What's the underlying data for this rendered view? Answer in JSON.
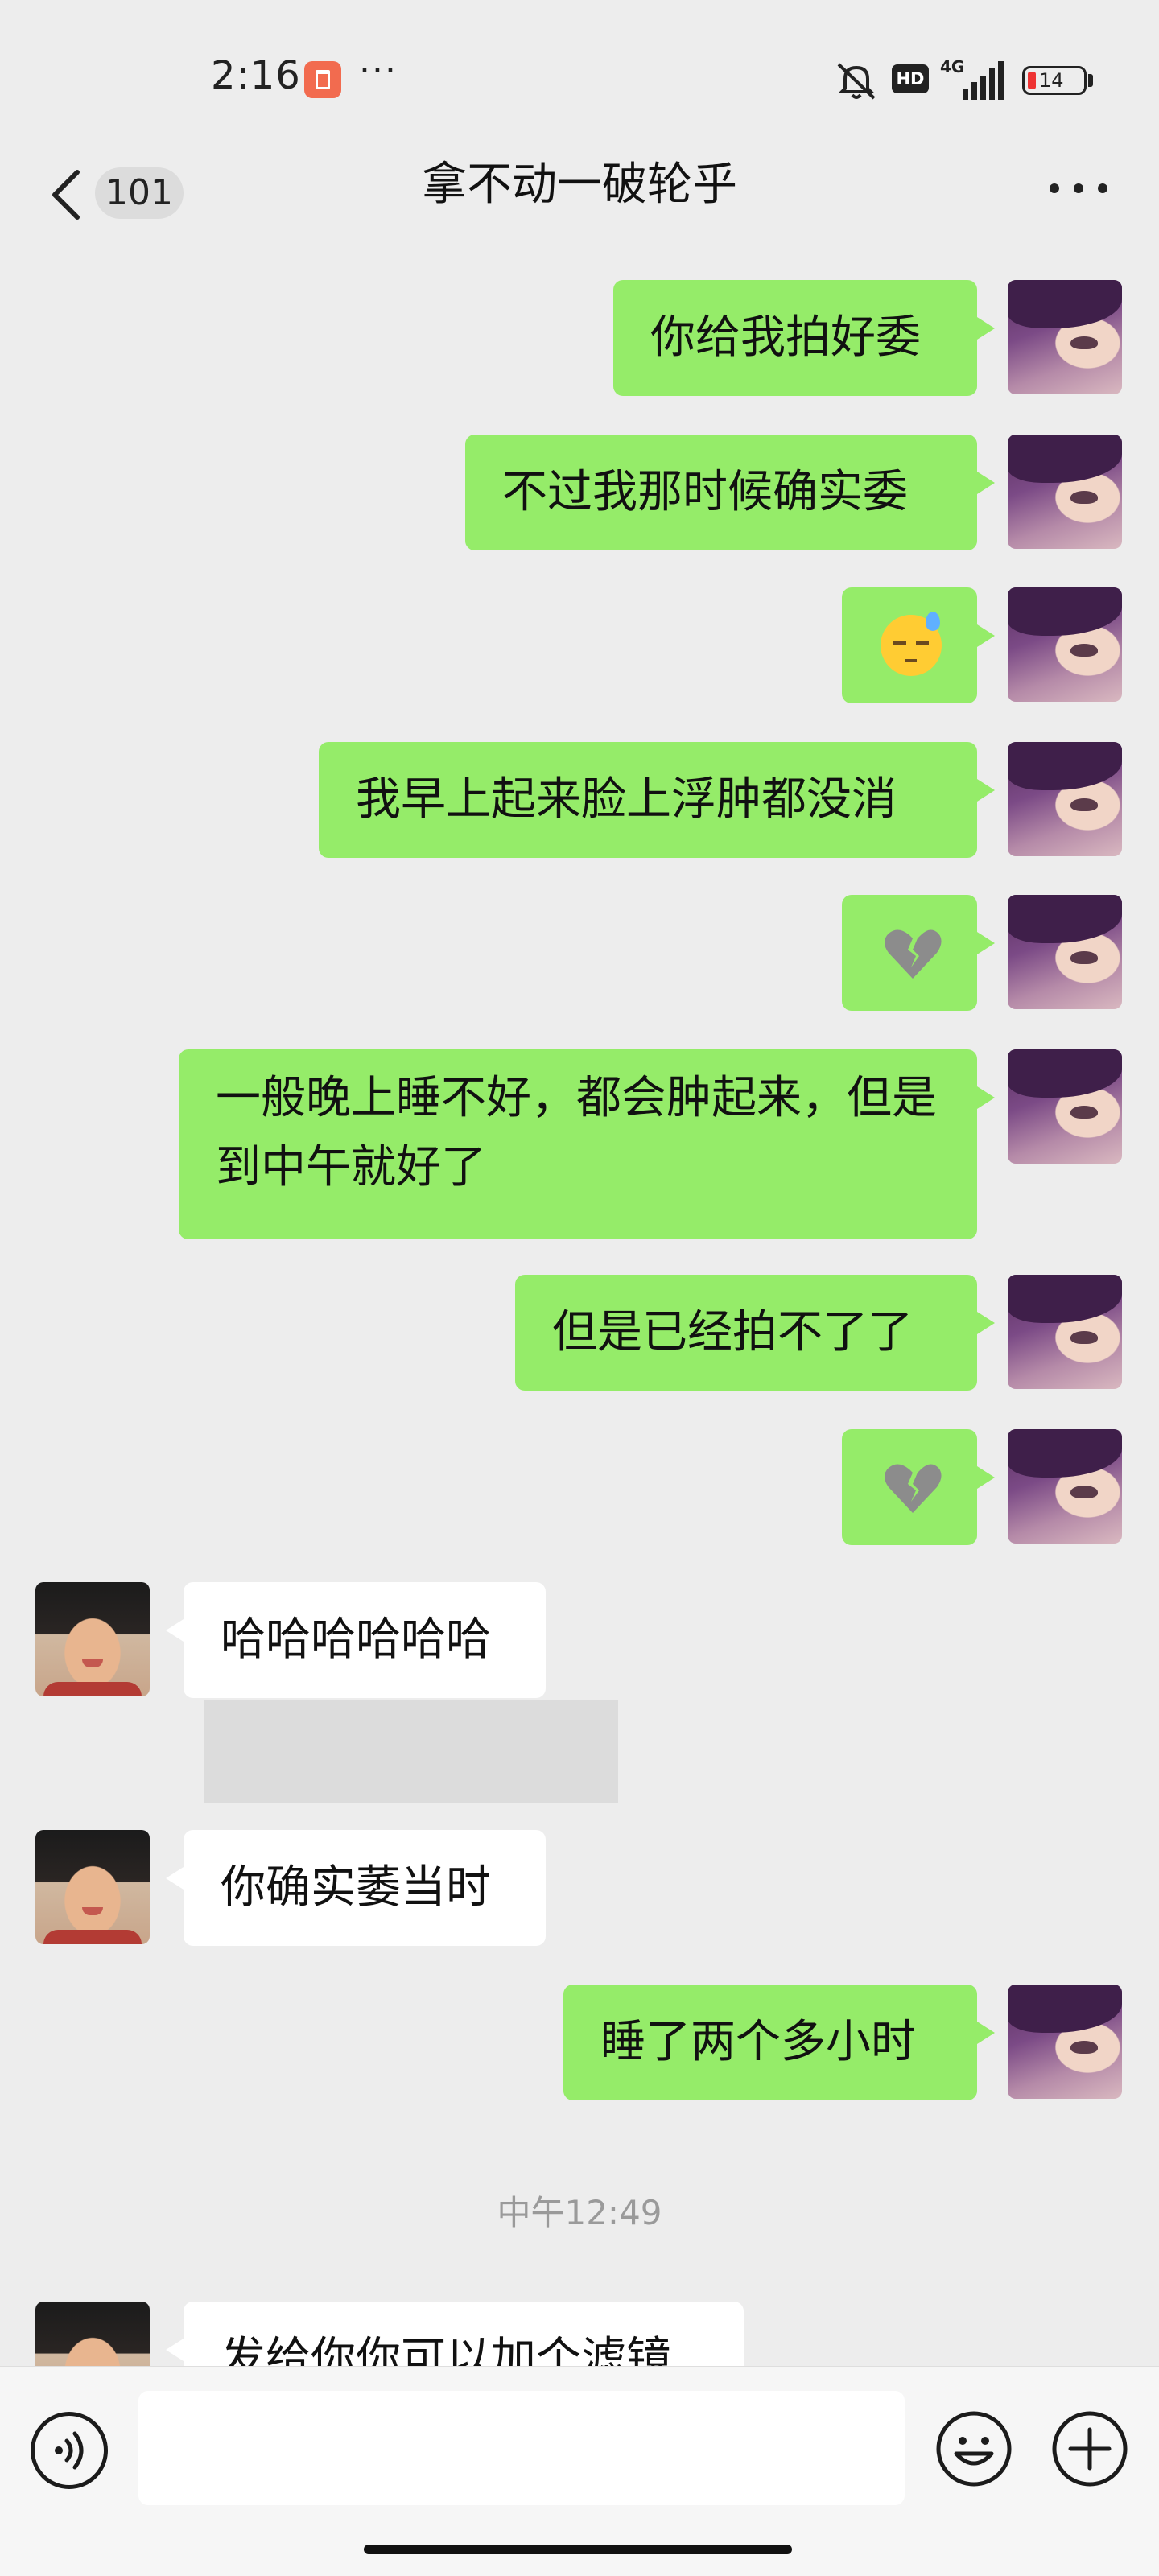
{
  "status_bar": {
    "time": "2:16",
    "more": "···",
    "hd": "HD",
    "network": "4G",
    "battery": "14"
  },
  "header": {
    "back_count": "101",
    "title": "拿不动一破轮乎"
  },
  "messages": [
    {
      "side": "me",
      "type": "text",
      "text": "你给我拍好委"
    },
    {
      "side": "me",
      "type": "text",
      "text": "不过我那时候确实委"
    },
    {
      "side": "me",
      "type": "emoji",
      "emoji": "sweat-smile-emoji"
    },
    {
      "side": "me",
      "type": "text",
      "text": "我早上起来脸上浮肿都没消"
    },
    {
      "side": "me",
      "type": "emoji",
      "emoji": "broken-heart-emoji"
    },
    {
      "side": "me",
      "type": "text",
      "text": "一般晚上睡不好，都会肿起来，但是到中午就好了"
    },
    {
      "side": "me",
      "type": "text",
      "text": "但是已经拍不了了"
    },
    {
      "side": "me",
      "type": "emoji",
      "emoji": "broken-heart-emoji"
    },
    {
      "side": "other",
      "type": "text",
      "text": "哈哈哈哈哈哈"
    },
    {
      "side": "other",
      "type": "text",
      "text": "你确实萎当时"
    },
    {
      "side": "me",
      "type": "text",
      "text": "睡了两个多小时"
    },
    {
      "side": "other",
      "type": "text",
      "text": "发给你你可以加个滤镜"
    }
  ],
  "timestamp": "中午12:49",
  "colors": {
    "bubble_me": "#95ec69",
    "bubble_other": "#ffffff",
    "background": "#ededed"
  },
  "input": {
    "value": "",
    "placeholder": ""
  }
}
